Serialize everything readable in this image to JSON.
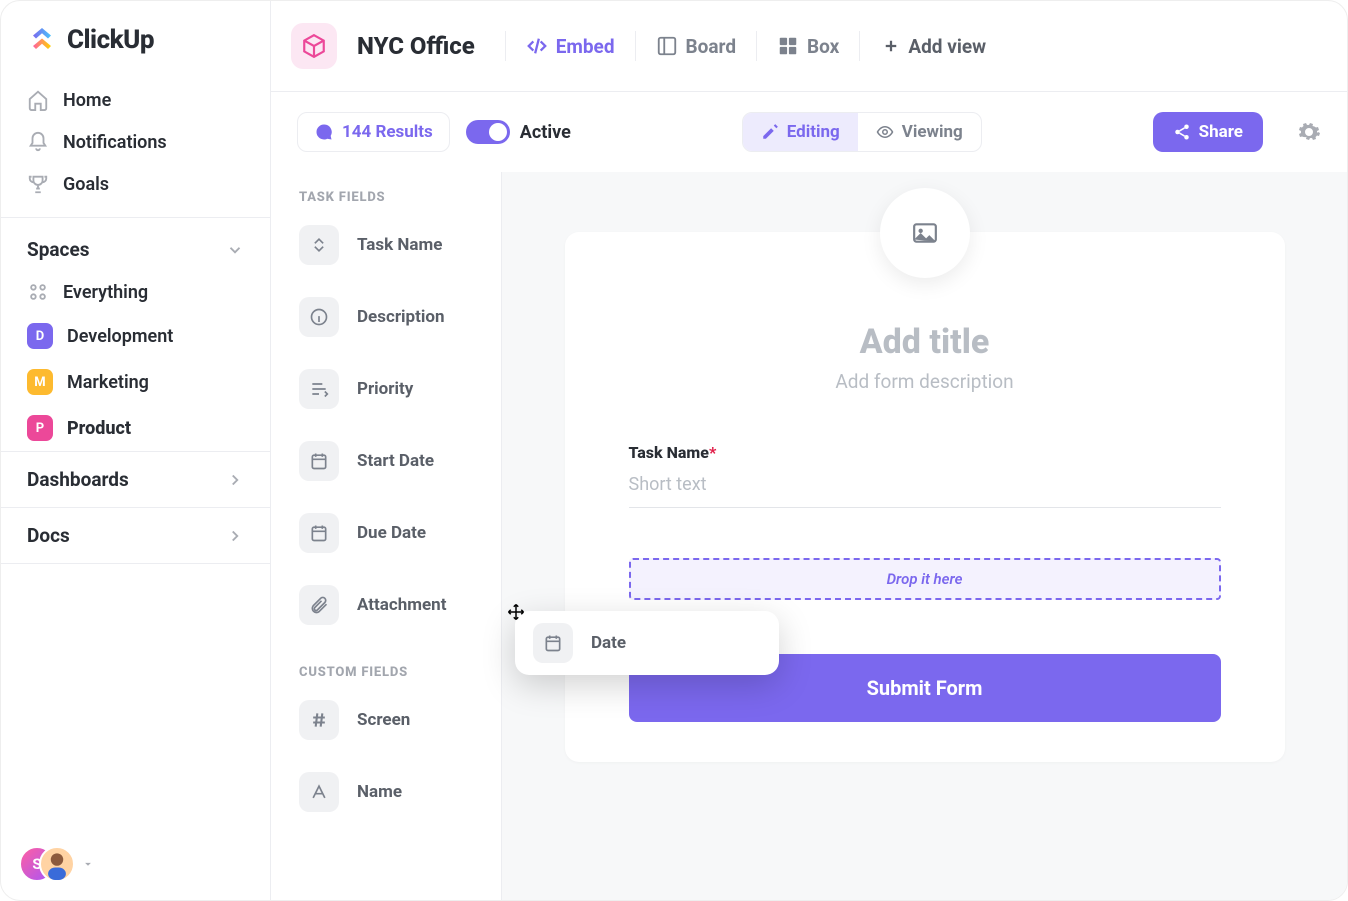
{
  "brand": {
    "name": "ClickUp"
  },
  "nav": {
    "home": "Home",
    "notifications": "Notifications",
    "goals": "Goals"
  },
  "sidebar": {
    "spaces_label": "Spaces",
    "everything": "Everything",
    "spaces": [
      {
        "letter": "D",
        "name": "Development",
        "color": "#7B68EE"
      },
      {
        "letter": "M",
        "name": "Marketing",
        "color": "#FDBA2F"
      },
      {
        "letter": "P",
        "name": "Product",
        "color": "#EC4899"
      }
    ],
    "dashboards": "Dashboards",
    "docs": "Docs",
    "user_initial": "S"
  },
  "header": {
    "page_title": "NYC Office",
    "views": {
      "embed": "Embed",
      "board": "Board",
      "box": "Box",
      "add": "Add view"
    }
  },
  "toolbar": {
    "results": "144 Results",
    "active": "Active",
    "editing": "Editing",
    "viewing": "Viewing",
    "share": "Share"
  },
  "fields_panel": {
    "task_fields_title": "TASK FIELDS",
    "custom_fields_title": "CUSTOM FIELDS",
    "task_fields": [
      "Task Name",
      "Description",
      "Priority",
      "Start Date",
      "Due Date",
      "Attachment"
    ],
    "custom_fields": [
      "Screen",
      "Name"
    ]
  },
  "drag": {
    "label": "Date"
  },
  "form": {
    "title_placeholder": "Add title",
    "desc_placeholder": "Add form description",
    "field_label": "Task Name",
    "field_placeholder": "Short text",
    "drop_hint": "Drop it here",
    "submit": "Submit Form"
  }
}
